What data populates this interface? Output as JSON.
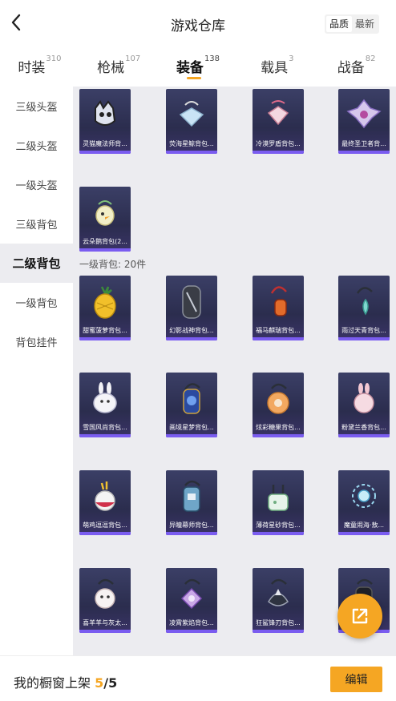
{
  "header": {
    "title": "游戏仓库",
    "back_icon": "chevron-left-icon",
    "sort_options": [
      "品质",
      "最新"
    ],
    "sort_selected": "品质"
  },
  "tabs": [
    {
      "label": "时装",
      "count": "310"
    },
    {
      "label": "枪械",
      "count": "107"
    },
    {
      "label": "装备",
      "count": "138",
      "active": true
    },
    {
      "label": "载具",
      "count": "3"
    },
    {
      "label": "战备",
      "count": "82"
    }
  ],
  "sidebar": {
    "items": [
      {
        "label": "三级头盔"
      },
      {
        "label": "二级头盔"
      },
      {
        "label": "一级头盔"
      },
      {
        "label": "三级背包"
      },
      {
        "label": "二级背包",
        "active": true
      },
      {
        "label": "一级背包"
      },
      {
        "label": "背包挂件"
      }
    ]
  },
  "content": {
    "top_items": [
      {
        "name": "灵猫魔法师背...",
        "icon": "cat-backpack-icon"
      },
      {
        "name": "荧海星鲸背包...",
        "icon": "whale-backpack-icon"
      },
      {
        "name": "冷漠罗盾背包...",
        "icon": "shield-backpack-icon"
      },
      {
        "name": "最终圣卫者背...",
        "icon": "guardian-backpack-icon"
      },
      {
        "name": "云朵鹅背包(2...",
        "icon": "goose-backpack-icon"
      }
    ],
    "section_label": "一级背包: 20件",
    "level1_items": [
      {
        "name": "甜蜜菠萝背包...",
        "icon": "pineapple-backpack-icon"
      },
      {
        "name": "幻影战神背包...",
        "icon": "phantom-backpack-icon"
      },
      {
        "name": "福马麒瑞背包...",
        "icon": "horse-backpack-icon"
      },
      {
        "name": "雨过天青背包...",
        "icon": "rain-backpack-icon"
      },
      {
        "name": "雪国风尚背包...",
        "icon": "snow-bunny-backpack-icon"
      },
      {
        "name": "画境星梦背包...",
        "icon": "star-dream-backpack-icon"
      },
      {
        "name": "炫彩糖果背包...",
        "icon": "candy-backpack-icon"
      },
      {
        "name": "粉黛兰香背包...",
        "icon": "pink-bunny-backpack-icon"
      },
      {
        "name": "萌鸡逗逗背包...",
        "icon": "chick-backpack-icon"
      },
      {
        "name": "异瞳幕师背包...",
        "icon": "robot-backpack-icon"
      },
      {
        "name": "薄荷星砂背包...",
        "icon": "mint-backpack-icon"
      },
      {
        "name": "魔童闹海·敖...",
        "icon": "orb-backpack-icon"
      },
      {
        "name": "喜羊羊与灰太...",
        "icon": "sheep-backpack-icon"
      },
      {
        "name": "凌霄紫焰背包...",
        "icon": "purple-flame-backpack-icon"
      },
      {
        "name": "狂鲨锋刃背包...",
        "icon": "shark-backpack-icon"
      },
      {
        "name": "",
        "icon": "black-backpack-icon"
      }
    ]
  },
  "fab": {
    "icon": "share-external-icon"
  },
  "bottom_bar": {
    "label": "我的橱窗上架",
    "current": "5",
    "separator": "/",
    "total": "5",
    "edit_label": "编辑"
  },
  "colors": {
    "accent": "#f5a623",
    "card_bg": "#2f3154",
    "card_bar": "#7a5cf0",
    "content_bg": "#ececf0"
  }
}
